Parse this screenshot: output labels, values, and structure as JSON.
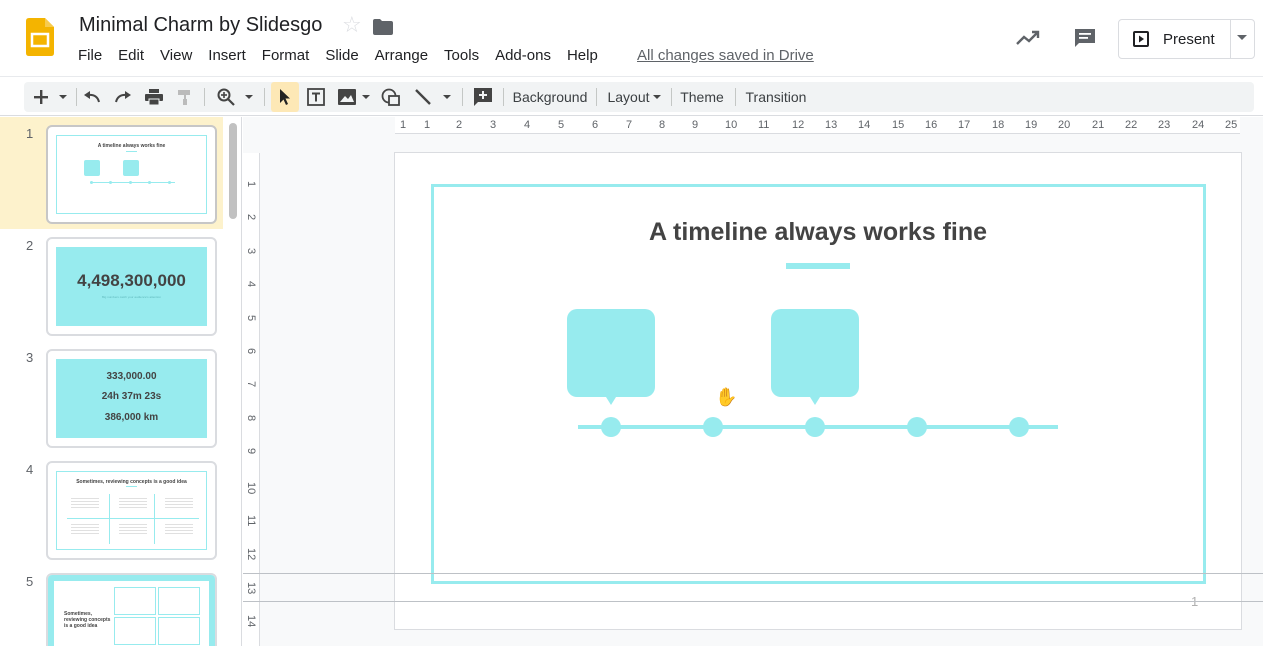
{
  "header": {
    "doc_title": "Minimal Charm by Slidesgo",
    "save_status": "All changes saved in Drive",
    "present_label": "Present",
    "menu": [
      "File",
      "Edit",
      "View",
      "Insert",
      "Format",
      "Slide",
      "Arrange",
      "Tools",
      "Add-ons",
      "Help"
    ],
    "icons": [
      "slides-logo-icon",
      "star-icon",
      "folder-icon",
      "activity-trend-icon",
      "comments-icon",
      "present-play-icon",
      "chevron-down-icon"
    ]
  },
  "toolbar": {
    "background_label": "Background",
    "layout_label": "Layout",
    "theme_label": "Theme",
    "transition_label": "Transition",
    "icons": [
      "new-slide-plus-icon",
      "undo-icon",
      "redo-icon",
      "print-icon",
      "paint-format-icon",
      "zoom-icon",
      "select-cursor-icon",
      "text-box-icon",
      "image-icon",
      "shape-icon",
      "line-icon",
      "add-comment-icon"
    ]
  },
  "filmstrip": {
    "slides": [
      {
        "number": "1",
        "title": "A timeline always works fine"
      },
      {
        "number": "2",
        "big_number": "4,498,300,000",
        "caption": "Big numbers catch your audience's attention"
      },
      {
        "number": "3",
        "stats": [
          "333,000.00",
          "24h 37m 23s",
          "386,000 km"
        ]
      },
      {
        "number": "4",
        "title": "Sometimes, reviewing concepts is a good idea"
      },
      {
        "number": "5",
        "title": "Sometimes, reviewing concepts is a good idea"
      }
    ]
  },
  "rulers": {
    "horizontal": [
      "1",
      "1",
      "2",
      "3",
      "4",
      "5",
      "6",
      "7",
      "8",
      "9",
      "10",
      "11",
      "12",
      "13",
      "14",
      "15",
      "16",
      "17",
      "18",
      "19",
      "20",
      "21",
      "22",
      "23",
      "24",
      "25"
    ],
    "vertical": [
      "1",
      "2",
      "3",
      "4",
      "5",
      "6",
      "7",
      "8",
      "9",
      "10",
      "11",
      "12",
      "13",
      "14"
    ]
  },
  "slide": {
    "title": "A timeline always works fine",
    "page_number": "1",
    "accent_color": "#97ebee",
    "title_color": "#434343"
  }
}
